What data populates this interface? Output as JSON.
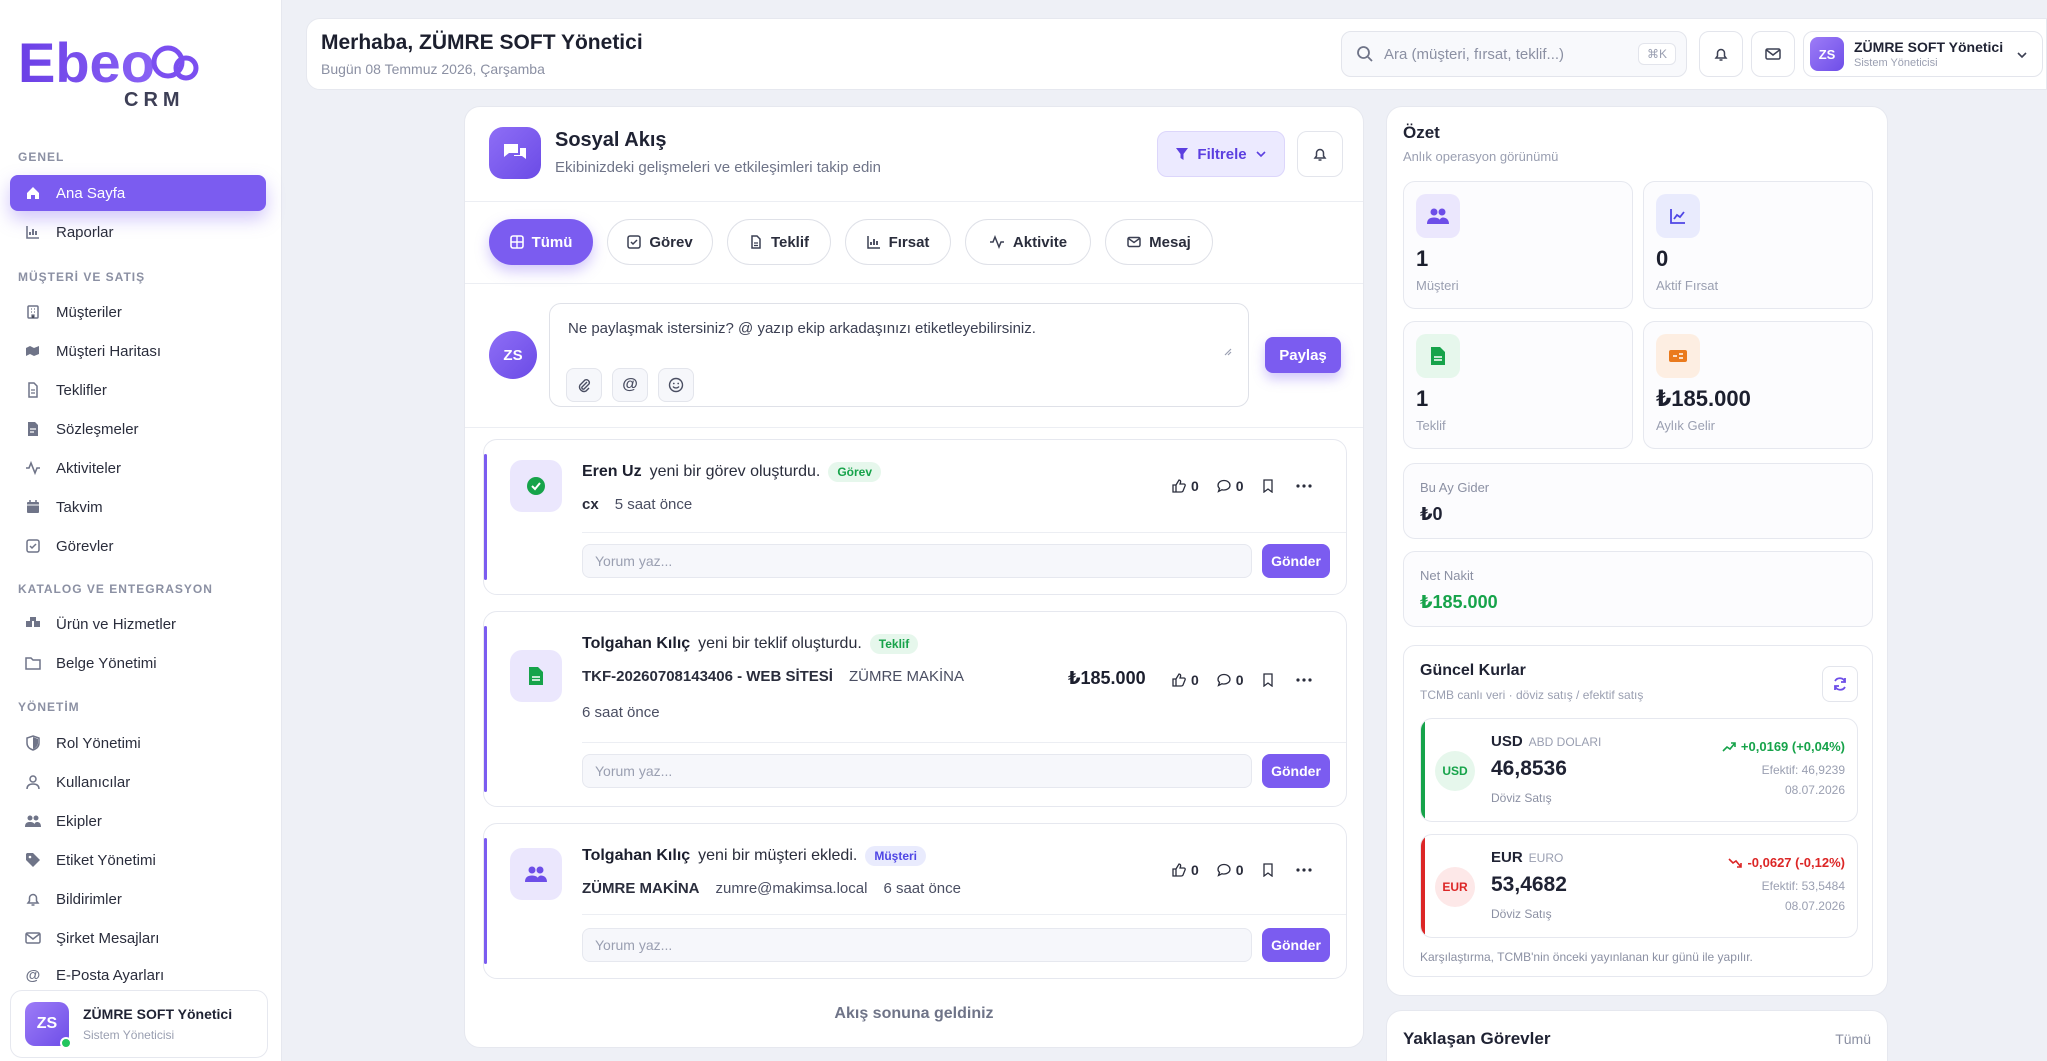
{
  "logo": {
    "name": "Ebeo",
    "sub": "CRM"
  },
  "sidebar": {
    "sections": [
      {
        "title": "GENEL",
        "items": [
          {
            "label": "Ana Sayfa",
            "icon": "home-icon",
            "active": true
          },
          {
            "label": "Raporlar",
            "icon": "chart-icon"
          }
        ]
      },
      {
        "title": "MÜŞTERİ VE SATIŞ",
        "items": [
          {
            "label": "Müşteriler",
            "icon": "building-icon"
          },
          {
            "label": "Müşteri Haritası",
            "icon": "map-icon"
          },
          {
            "label": "Teklifler",
            "icon": "document-icon"
          },
          {
            "label": "Sözleşmeler",
            "icon": "contract-icon"
          },
          {
            "label": "Aktiviteler",
            "icon": "activity-icon"
          },
          {
            "label": "Takvim",
            "icon": "calendar-icon"
          },
          {
            "label": "Görevler",
            "icon": "check-square-icon"
          }
        ]
      },
      {
        "title": "KATALOG VE ENTEGRASYON",
        "items": [
          {
            "label": "Ürün ve Hizmetler",
            "icon": "boxes-icon"
          },
          {
            "label": "Belge Yönetimi",
            "icon": "folder-icon"
          }
        ]
      },
      {
        "title": "YÖNETİM",
        "items": [
          {
            "label": "Rol Yönetimi",
            "icon": "shield-icon"
          },
          {
            "label": "Kullanıcılar",
            "icon": "user-icon"
          },
          {
            "label": "Ekipler",
            "icon": "users-icon"
          },
          {
            "label": "Etiket Yönetimi",
            "icon": "tag-icon"
          },
          {
            "label": "Bildirimler",
            "icon": "bell-icon"
          },
          {
            "label": "Şirket Mesajları",
            "icon": "mail-icon"
          },
          {
            "label": "E-Posta Ayarları",
            "icon": "at-icon"
          }
        ]
      }
    ],
    "user": {
      "initials": "ZS",
      "name": "ZÜMRE SOFT Yönetici",
      "role": "Sistem Yöneticisi"
    }
  },
  "header": {
    "greeting": "Merhaba, ZÜMRE SOFT Yönetici",
    "date": "Bugün 08 Temmuz 2026, Çarşamba",
    "search_placeholder": "Ara (müşteri, fırsat, teklif...)",
    "shortcut": "⌘K",
    "user": {
      "initials": "ZS",
      "name": "ZÜMRE SOFT Yönetici",
      "role": "Sistem Yöneticisi"
    }
  },
  "feed": {
    "title": "Sosyal Akış",
    "subtitle": "Ekibinizdeki gelişmeleri ve etkileşimleri takip edin",
    "filter_label": "Filtrele",
    "tabs": [
      {
        "label": "Tümü",
        "icon": "grid-icon",
        "active": true
      },
      {
        "label": "Görev",
        "icon": "check-square-icon"
      },
      {
        "label": "Teklif",
        "icon": "document-icon"
      },
      {
        "label": "Fırsat",
        "icon": "chart-icon"
      },
      {
        "label": "Aktivite",
        "icon": "activity-icon"
      },
      {
        "label": "Mesaj",
        "icon": "mail-icon"
      }
    ],
    "composer": {
      "initials": "ZS",
      "placeholder": "Ne paylaşmak istersiniz? @ yazıp ekip arkadaşınızı etiketleyebilirsiniz.",
      "share_label": "Paylaş"
    },
    "posts": [
      {
        "author": "Eren Uz",
        "action": "yeni bir görev oluşturdu.",
        "tag": "Görev",
        "tag_color": "#16a34a",
        "tag_bg": "#e6f7ec",
        "icon": "check-circle-icon",
        "meta": [
          "cx",
          "5 saat önce"
        ],
        "likes": "0",
        "comments": "0",
        "comment_placeholder": "Yorum yaz...",
        "send": "Gönder"
      },
      {
        "author": "Tolgahan Kılıç",
        "action": "yeni bir teklif oluşturdu.",
        "tag": "Teklif",
        "tag_color": "#16a34a",
        "tag_bg": "#e6f7ec",
        "icon": "document-icon",
        "meta": [
          "TKF-20260708143406 - WEB SİTESİ",
          "ZÜMRE MAKİNA"
        ],
        "time": "6 saat önce",
        "amount": "₺185.000",
        "likes": "0",
        "comments": "0",
        "comment_placeholder": "Yorum yaz...",
        "send": "Gönder"
      },
      {
        "author": "Tolgahan Kılıç",
        "action": "yeni bir müşteri ekledi.",
        "tag": "Müşteri",
        "tag_color": "#4f46e5",
        "tag_bg": "#e9ebfd",
        "icon": "users-icon",
        "meta": [
          "ZÜMRE MAKİNA",
          "zumre@makimsa.local",
          "6 saat önce"
        ],
        "likes": "0",
        "comments": "0",
        "comment_placeholder": "Yorum yaz...",
        "send": "Gönder"
      }
    ],
    "end_text": "Akış sonuna geldiniz"
  },
  "summary": {
    "title": "Özet",
    "subtitle": "Anlık operasyon görünümü",
    "stats": [
      {
        "value": "1",
        "label": "Müşteri",
        "icon": "users-icon",
        "color": "#6d4ee8",
        "bg": "#ebe7fd"
      },
      {
        "value": "0",
        "label": "Aktif Fırsat",
        "icon": "chart-icon",
        "color": "#4f46e5",
        "bg": "#e9ebfd"
      },
      {
        "value": "1",
        "label": "Teklif",
        "icon": "document-icon",
        "color": "#16a34a",
        "bg": "#e6f7ec"
      },
      {
        "value": "₺185.000",
        "label": "Aylık Gelir",
        "icon": "money-icon",
        "color": "#ea7a1d",
        "bg": "#fdeee2"
      }
    ],
    "expense": {
      "label": "Bu Ay Gider",
      "value": "₺0"
    },
    "net": {
      "label": "Net Nakit",
      "value": "₺185.000",
      "color": "#16a34a"
    }
  },
  "rates": {
    "title": "Güncel Kurlar",
    "subtitle": "TCMB canlı veri · döviz satış / efektif satış",
    "items": [
      {
        "code": "USD",
        "name": "ABD DOLARI",
        "value": "46,8536",
        "value_label": "Döviz Satış",
        "change": "+0,0169 (+0,04%)",
        "direction": "up",
        "effective": "Efektif: 46,9239",
        "date": "08.07.2026",
        "color": "#16a34a",
        "bg": "#e6f7ec"
      },
      {
        "code": "EUR",
        "name": "EURO",
        "value": "53,4682",
        "value_label": "Döviz Satış",
        "change": "-0,0627 (-0,12%)",
        "direction": "down",
        "effective": "Efektif: 53,5484",
        "date": "08.07.2026",
        "color": "#dc2626",
        "bg": "#fde8e8"
      }
    ],
    "note": "Karşılaştırma, TCMB'nin önceki yayınlanan kur günü ile yapılır."
  },
  "tasks": {
    "title": "Yaklaşan Görevler",
    "all_label": "Tümü"
  }
}
